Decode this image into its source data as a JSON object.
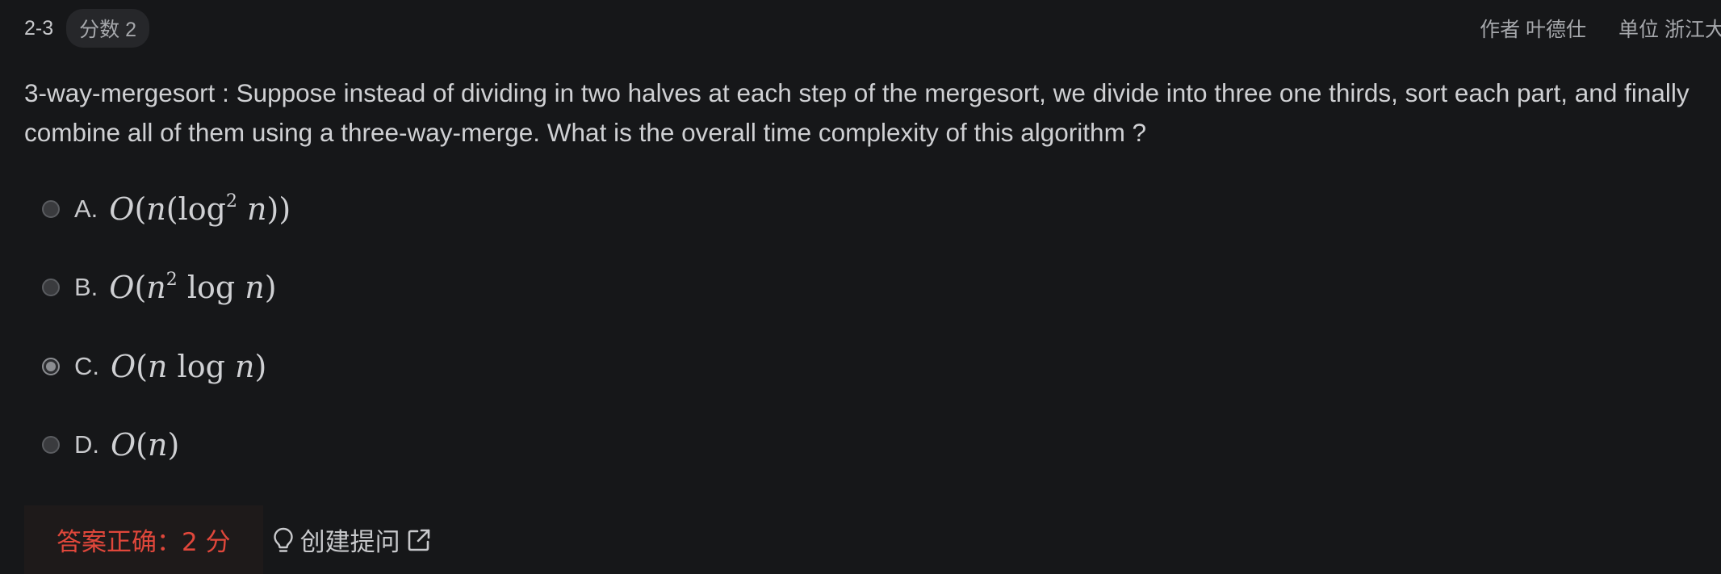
{
  "header": {
    "question_number": "2-3",
    "score_label": "分数 2",
    "author": "作者 叶德仕",
    "unit": "单位 浙江大学"
  },
  "question": {
    "text": "3-way-mergesort : Suppose instead of dividing in two halves at each step of the mergesort, we divide into three one thirds, sort each part, and finally combine all of them using a three-way-merge. What is the overall time complexity of this algorithm ?"
  },
  "options": [
    {
      "letter": "A.",
      "formula": "O(n(log² n))",
      "selected": false
    },
    {
      "letter": "B.",
      "formula": "O(n² log n)",
      "selected": false
    },
    {
      "letter": "C.",
      "formula": "O(n log n)",
      "selected": true
    },
    {
      "letter": "D.",
      "formula": "O(n)",
      "selected": false
    }
  ],
  "footer": {
    "result": "答案正确：2 分",
    "hint_label": "创建提问",
    "hint_icon": "lightbulb-icon",
    "external_icon": "external-link-icon"
  },
  "colors": {
    "background": "#161719",
    "correct": "#e0473b",
    "text": "#cfd0d3"
  }
}
